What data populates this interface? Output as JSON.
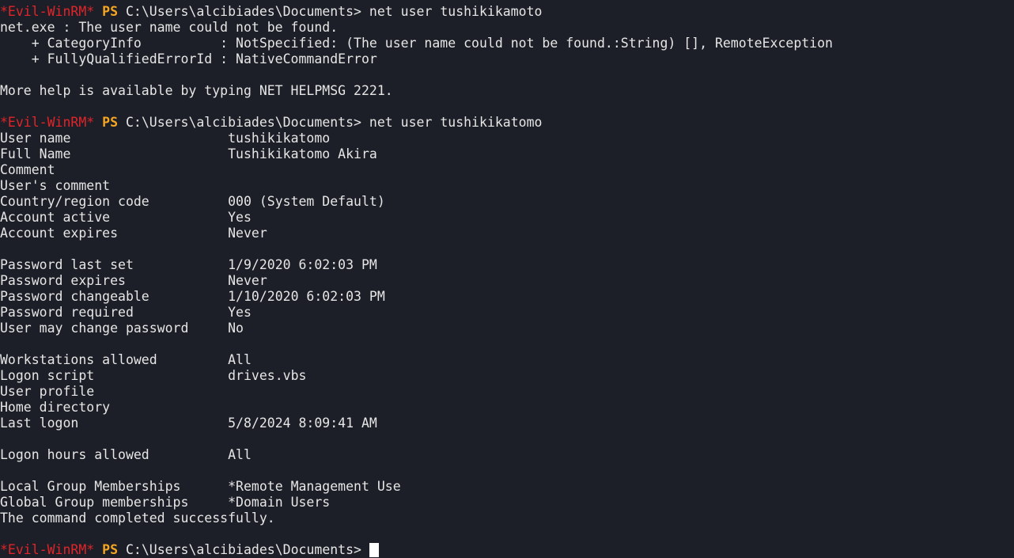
{
  "prompt": {
    "evil": "*Evil-WinRM*",
    "ps": "PS",
    "path": "C:\\Users\\alcibiades\\Documents>"
  },
  "commands": [
    "net user tushikikamoto",
    "net user tushikikatomo"
  ],
  "error": {
    "line1": "net.exe : The user name could not be found.",
    "line2": "    + CategoryInfo          : NotSpecified: (The user name could not be found.:String) [], RemoteException",
    "line3": "    + FullyQualifiedErrorId : NativeCommandError",
    "help": "More help is available by typing NET HELPMSG 2221."
  },
  "user_info": [
    {
      "label": "User name                    ",
      "value": "tushikikatomo"
    },
    {
      "label": "Full Name                    ",
      "value": "Tushikikatomo Akira"
    },
    {
      "label": "Comment                      ",
      "value": ""
    },
    {
      "label": "User's comment               ",
      "value": ""
    },
    {
      "label": "Country/region code          ",
      "value": "000 (System Default)"
    },
    {
      "label": "Account active               ",
      "value": "Yes"
    },
    {
      "label": "Account expires              ",
      "value": "Never"
    },
    {
      "label": "",
      "value": ""
    },
    {
      "label": "Password last set            ",
      "value": "1/9/2020 6:02:03 PM"
    },
    {
      "label": "Password expires             ",
      "value": "Never"
    },
    {
      "label": "Password changeable          ",
      "value": "1/10/2020 6:02:03 PM"
    },
    {
      "label": "Password required            ",
      "value": "Yes"
    },
    {
      "label": "User may change password     ",
      "value": "No"
    },
    {
      "label": "",
      "value": ""
    },
    {
      "label": "Workstations allowed         ",
      "value": "All"
    },
    {
      "label": "Logon script                 ",
      "value": "drives.vbs"
    },
    {
      "label": "User profile                 ",
      "value": ""
    },
    {
      "label": "Home directory               ",
      "value": ""
    },
    {
      "label": "Last logon                   ",
      "value": "5/8/2024 8:09:41 AM"
    },
    {
      "label": "",
      "value": ""
    },
    {
      "label": "Logon hours allowed          ",
      "value": "All"
    },
    {
      "label": "",
      "value": ""
    },
    {
      "label": "Local Group Memberships      ",
      "value": "*Remote Management Use"
    },
    {
      "label": "Global Group memberships     ",
      "value": "*Domain Users"
    }
  ],
  "completion": "The command completed successfully."
}
